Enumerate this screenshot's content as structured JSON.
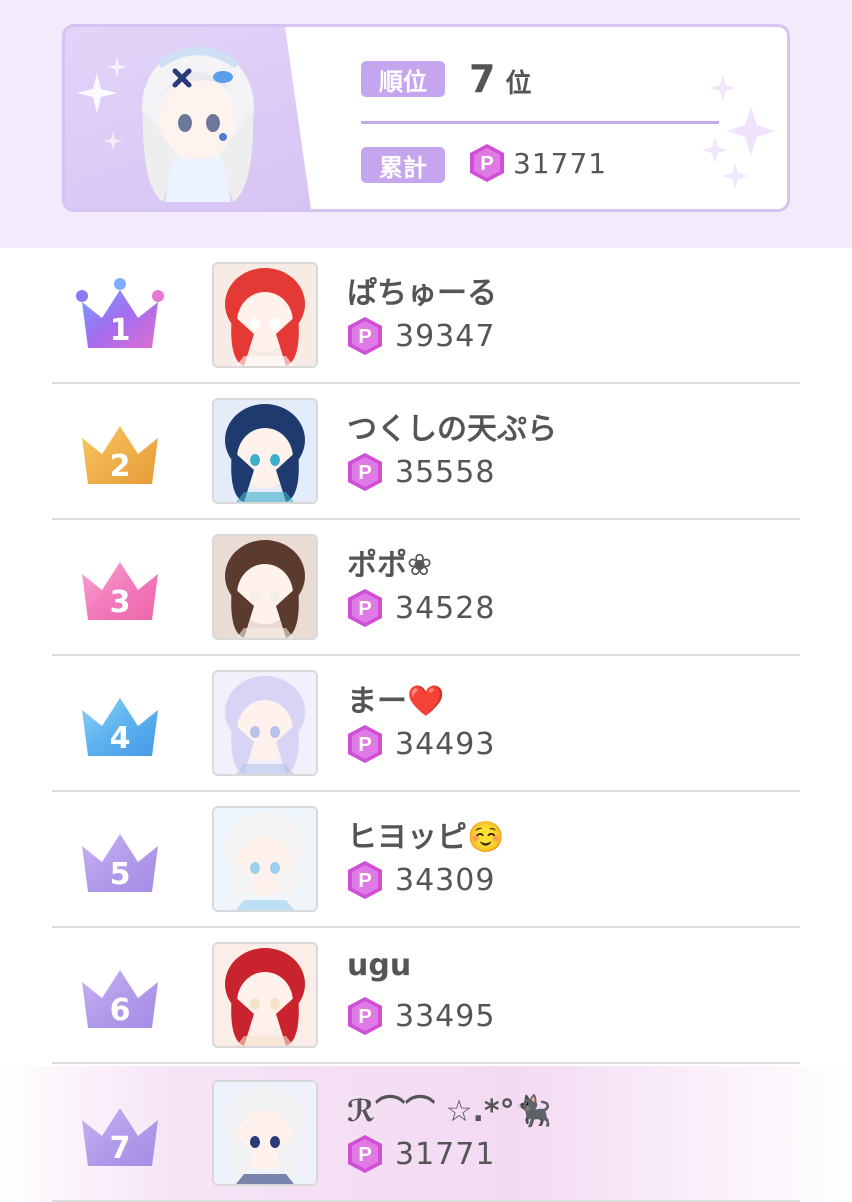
{
  "summary": {
    "rank_label": "順位",
    "rank_value": "7",
    "rank_suffix": "位",
    "total_label": "累計",
    "total_value": "31771",
    "coin_icon": "p-point-icon"
  },
  "colors": {
    "accent_purple": "#c5a6ee",
    "band_bg": "#f1ebfb",
    "coin": "#d04fd6",
    "highlight_row": "#f3daf3"
  },
  "ranking": [
    {
      "rank": "1",
      "name": "ぱちゅーる",
      "points": "39347",
      "crown": "gradient-blue-purple-crown"
    },
    {
      "rank": "2",
      "name": "つくしの天ぷら",
      "points": "35558",
      "crown": "gold-crown"
    },
    {
      "rank": "3",
      "name": "ポポ❀",
      "points": "34528",
      "crown": "pink-crown"
    },
    {
      "rank": "4",
      "name": "まー❤️",
      "points": "34493",
      "crown": "blue-crown"
    },
    {
      "rank": "5",
      "name": "ヒヨッピ☺️",
      "points": "34309",
      "crown": "purple-crown"
    },
    {
      "rank": "6",
      "name": "ugu",
      "points": "33495",
      "crown": "purple-crown"
    },
    {
      "rank": "7",
      "name": "ℛ⌒⌒ ☆.*°🐈‍⬛",
      "points": "31771",
      "crown": "purple-crown"
    }
  ]
}
